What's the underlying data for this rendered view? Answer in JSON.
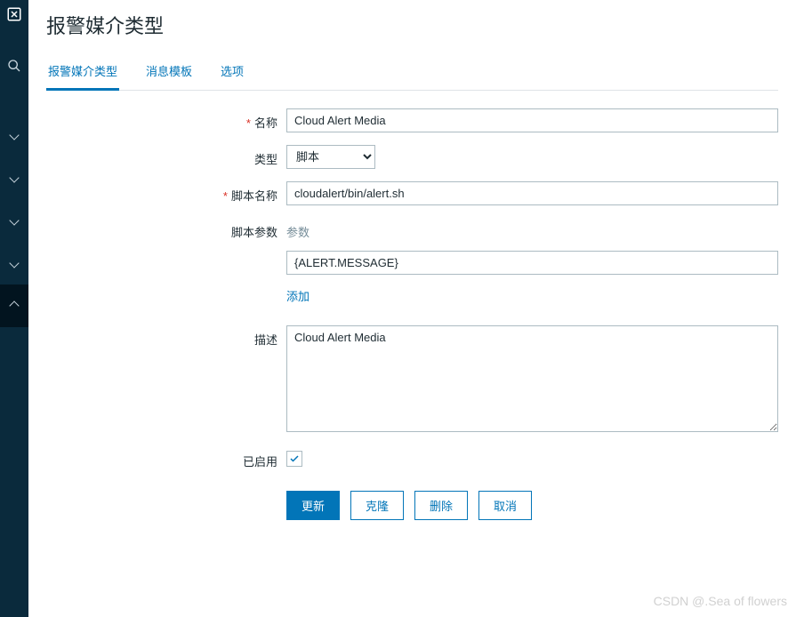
{
  "page": {
    "title": "报警媒介类型"
  },
  "tabs": {
    "items": [
      {
        "label": "报警媒介类型",
        "active": true
      },
      {
        "label": "消息模板",
        "active": false
      },
      {
        "label": "选项",
        "active": false
      }
    ]
  },
  "form": {
    "name_label": "名称",
    "name_value": "Cloud Alert Media",
    "type_label": "类型",
    "type_value": "脚本",
    "script_name_label": "脚本名称",
    "script_name_value": "cloudalert/bin/alert.sh",
    "script_params_label": "脚本参数",
    "script_params_header": "参数",
    "script_params": [
      "{ALERT.MESSAGE}"
    ],
    "add_label": "添加",
    "description_label": "描述",
    "description_value": "Cloud Alert Media",
    "enabled_label": "已启用",
    "enabled_value": true
  },
  "buttons": {
    "update": "更新",
    "clone": "克隆",
    "delete": "删除",
    "cancel": "取消"
  },
  "watermark": "CSDN @.Sea of flowers"
}
